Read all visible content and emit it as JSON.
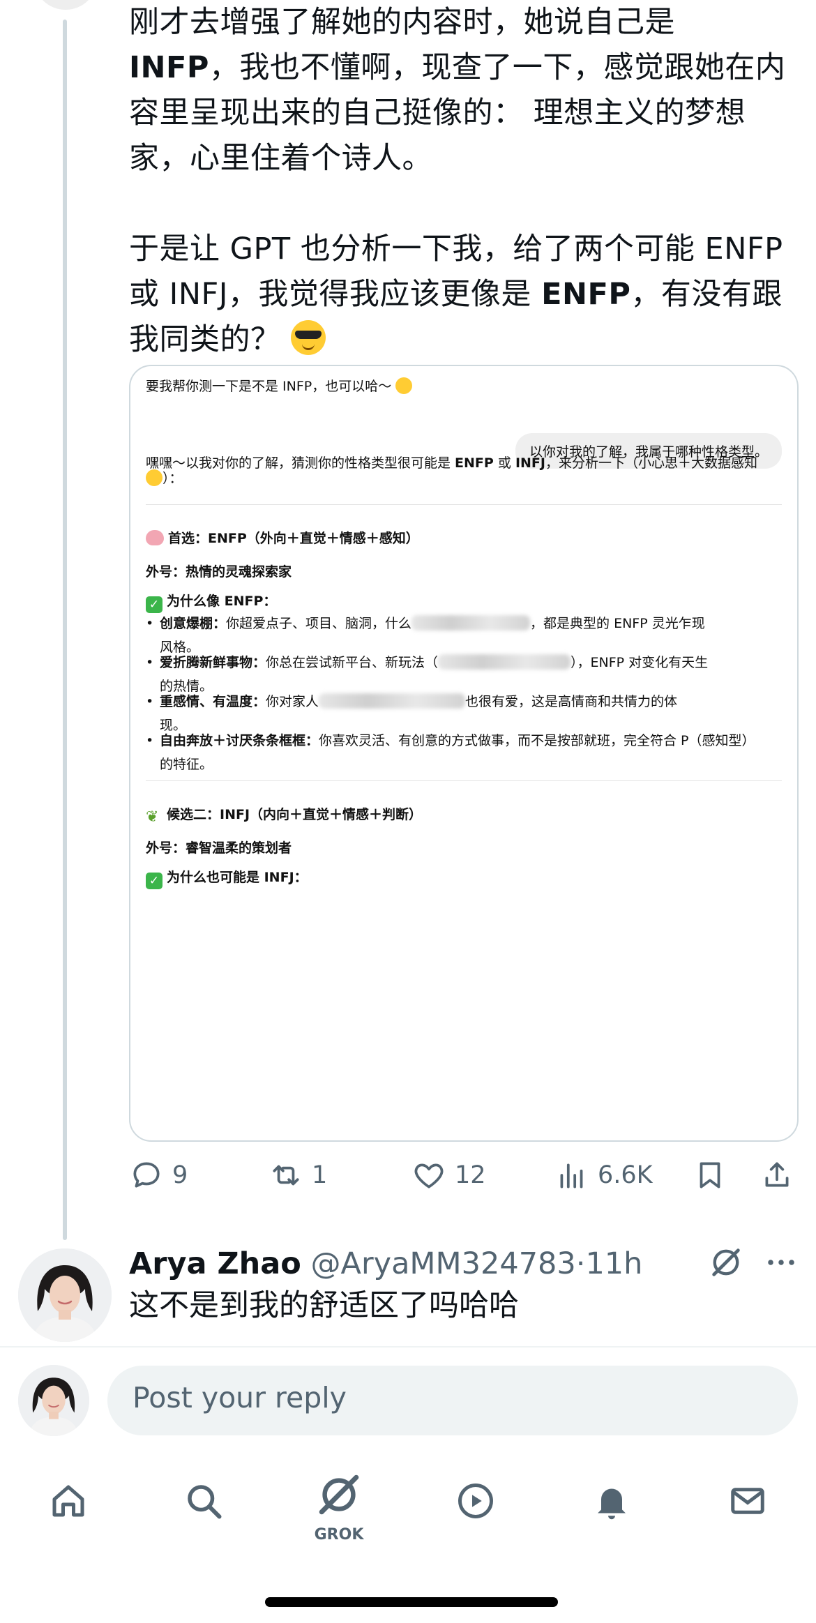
{
  "tweet": {
    "para1_a": "刚才去增强了解她的内容时，她说自己是",
    "para1_bold": "INFP",
    "para1_b": "，我也不懂啊，现查了一下，感觉跟她在内",
    "para1_c": "容里呈现出来的自己挺像的： 理想主义的梦想",
    "para1_d": "家，心里住着个诗人。",
    "para2_a": "于是让 GPT 也分析一下我，给了两个可能 ENFP",
    "para2_b": "或 INFJ，我觉得我应该更像是 ",
    "para2_bold": "ENFP",
    "para2_c": "，有没有跟",
    "para2_d": "我同类的？",
    "emoji": "smiling-face-with-sunglasses"
  },
  "card": {
    "line1": "要我帮你测一下是不是 INFP，也可以哈～",
    "bubble": "以你对我的了解，我属于哪种性格类型。",
    "intro_a": "嘿嘿～以我对你的了解，猜测你的性格类型很可能是 ",
    "intro_b1": "ENFP",
    "intro_or": " 或 ",
    "intro_b2": "INFJ",
    "intro_c": "，来分析一下（小心思＋大数据感知",
    "intro_d": "）：",
    "h1": "首选：ENFP（外向＋直觉＋情感＋感知）",
    "nick1": "外号：热情的灵魂探索家",
    "why1": "为什么像 ENFP：",
    "b1_bold": "创意爆棚：",
    "b1_a": "你超爱点子、项目、脑洞，什么",
    "b1_b": "，都是典型的 ENFP 灵光乍现",
    "b1_c": "风格。",
    "b2_bold": "爱折腾新鲜事物：",
    "b2_a": "你总在尝试新平台、新玩法（",
    "b2_b": "），ENFP 对变化有天生",
    "b2_c": "的热情。",
    "b3_bold": "重感情、有温度：",
    "b3_a": "你对家人",
    "b3_b": "也很有爱，这是高情商和共情力的体",
    "b3_c": "现。",
    "b4_bold": "自由奔放＋讨厌条条框框：",
    "b4_a": "你喜欢灵活、有创意的方式做事，而不是按部就班，完全符合 P（感知型）",
    "b4_c": "的特征。",
    "h2": "候选二：INFJ（内向＋直觉＋情感＋判断）",
    "nick2": "外号：睿智温柔的策划者",
    "why2": "为什么也可能是 INFJ："
  },
  "actions": {
    "replies": "9",
    "reposts": "1",
    "likes": "12",
    "views": "6.6K"
  },
  "reply": {
    "name": "Arya Zhao",
    "handle": "@AryaMM324783",
    "dot": "·",
    "time": "11h",
    "text": "这不是到我的舒适区了吗哈哈"
  },
  "composer": {
    "placeholder": "Post your reply"
  },
  "tabbar": {
    "grok_label": "GROK"
  },
  "colors": {
    "text": "#0f1419",
    "muted": "#536471",
    "border": "#cfd9de",
    "input_bg": "#eff3f4"
  }
}
